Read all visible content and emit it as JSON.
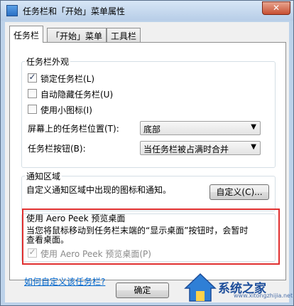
{
  "window": {
    "title": "任务栏和「开始」菜单属性",
    "close_label": "✕"
  },
  "tabs": [
    {
      "label": "任务栏",
      "active": true
    },
    {
      "label": "「开始」菜单",
      "active": false
    },
    {
      "label": "工具栏",
      "active": false
    }
  ],
  "appearance": {
    "title": "任务栏外观",
    "lock_label": "锁定任务栏(L)",
    "lock_checked": true,
    "autohide_label": "自动隐藏任务栏(U)",
    "autohide_checked": false,
    "small_icons_label": "使用小图标(I)",
    "small_icons_checked": false,
    "location_label": "屏幕上的任务栏位置(T):",
    "location_value": "底部",
    "buttons_label": "任务栏按钮(B):",
    "buttons_value": "当任务栏被占满时合并"
  },
  "notification": {
    "title": "通知区域",
    "description": "自定义通知区域中出现的图标和通知。",
    "customize_button": "自定义(C)..."
  },
  "aero_peek": {
    "title": "使用 Aero Peek 预览桌面",
    "description_line1": "当您将鼠标移动到任务栏末端的“显示桌面”按钮时，会暂时",
    "description_line2": "查看桌面。",
    "checkbox_label": "使用 Aero Peek 预览桌面(P)",
    "checkbox_checked": true
  },
  "help_link": "如何自定义该任务栏?",
  "ok_button": "确定",
  "watermark": {
    "text": "系统之家",
    "url": "www.xitongzhijia.net"
  }
}
